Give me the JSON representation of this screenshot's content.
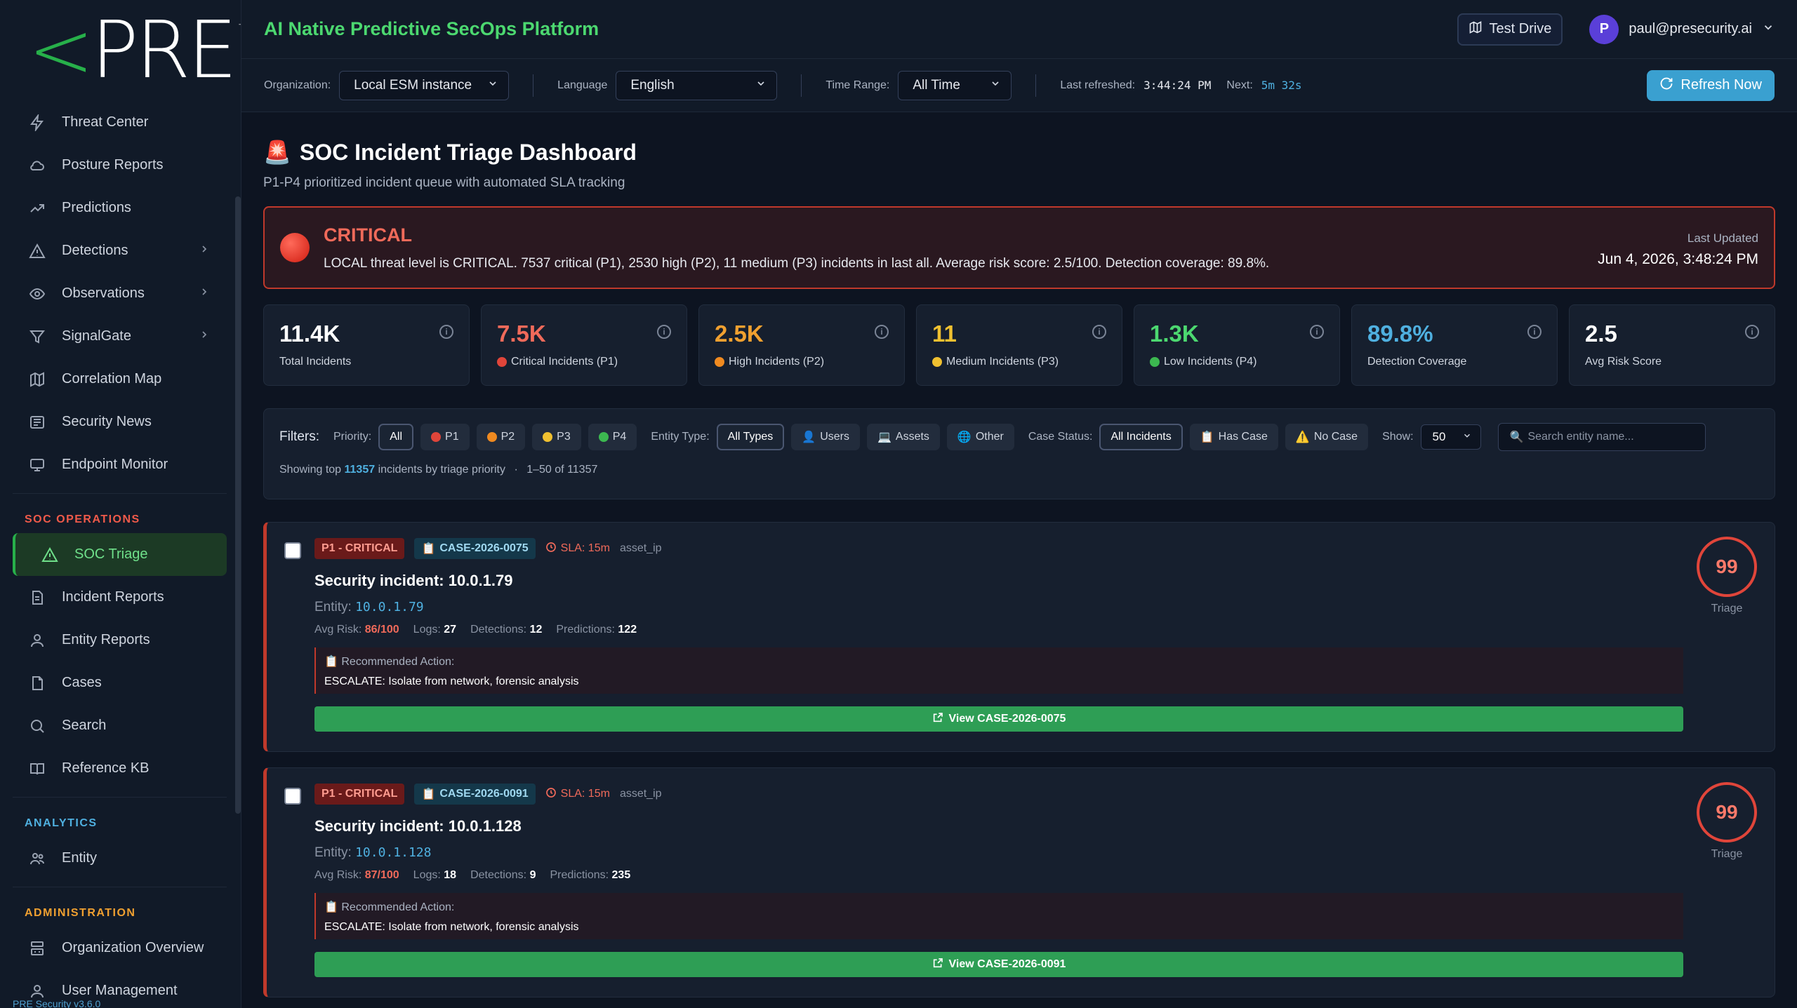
{
  "sidebar": {
    "logo": {
      "lt": "<",
      "text": "PRE",
      "tm": "TM"
    },
    "items_top": [
      {
        "label": "Threat Center",
        "icon": "bolt-icon"
      },
      {
        "label": "Posture Reports",
        "icon": "cloud-icon"
      },
      {
        "label": "Predictions",
        "icon": "trend-icon"
      },
      {
        "label": "Detections",
        "icon": "warning-icon",
        "chevron": true
      },
      {
        "label": "Observations",
        "icon": "eye-icon",
        "chevron": true
      },
      {
        "label": "SignalGate",
        "icon": "funnel-icon",
        "chevron": true
      },
      {
        "label": "Correlation Map",
        "icon": "map-icon"
      },
      {
        "label": "Security News",
        "icon": "news-icon"
      },
      {
        "label": "Endpoint Monitor",
        "icon": "monitor-icon"
      }
    ],
    "soc_heading": "SOC OPERATIONS",
    "soc_items": [
      {
        "label": "SOC Triage",
        "icon": "warning-icon",
        "active": true
      },
      {
        "label": "Incident Reports",
        "icon": "doc-icon"
      },
      {
        "label": "Entity Reports",
        "icon": "user-icon"
      },
      {
        "label": "Cases",
        "icon": "file-icon"
      },
      {
        "label": "Search",
        "icon": "search-icon"
      },
      {
        "label": "Reference KB",
        "icon": "book-icon"
      }
    ],
    "analytics_heading": "ANALYTICS",
    "analytics_items": [
      {
        "label": "Entity",
        "icon": "users-icon"
      }
    ],
    "admin_heading": "ADMINISTRATION",
    "admin_items": [
      {
        "label": "Organization Overview",
        "icon": "org-icon"
      },
      {
        "label": "User Management",
        "icon": "user-group-icon"
      }
    ],
    "version": "PRE Security v3.6.0"
  },
  "header": {
    "title": "AI Native Predictive SecOps Platform",
    "test_drive": "Test Drive",
    "user_initial": "P",
    "user_email": "paul@presecurity.ai"
  },
  "filterbar": {
    "org_label": "Organization:",
    "org_value": "Local ESM instance",
    "lang_label": "Language",
    "lang_value": "English",
    "time_label": "Time Range:",
    "time_value": "All Time",
    "last_refreshed_label": "Last refreshed:",
    "last_refreshed_value": "3:44:24 PM",
    "next_label": "Next:",
    "next_value": "5m 32s",
    "refresh_label": "Refresh Now"
  },
  "page": {
    "icon": "🚨",
    "title": "SOC Incident Triage Dashboard",
    "subtitle": "P1-P4 prioritized incident queue with automated SLA tracking"
  },
  "alert": {
    "level": "CRITICAL",
    "text": "LOCAL threat level is CRITICAL. 7537 critical (P1), 2530 high (P2), 11 medium (P3) incidents in last all. Average risk score: 2.5/100. Detection coverage: 89.8%.",
    "updated_label": "Last Updated",
    "updated_value": "Jun 4, 2026, 3:48:24 PM"
  },
  "stats": [
    {
      "value": "11.4K",
      "label": "Total Incidents",
      "color": "#ffffff",
      "dot": ""
    },
    {
      "value": "7.5K",
      "label": "Critical Incidents (P1)",
      "color": "#f06a5a",
      "dot": "#e0453a"
    },
    {
      "value": "2.5K",
      "label": "High Incidents (P2)",
      "color": "#f0a030",
      "dot": "#f08a20"
    },
    {
      "value": "11",
      "label": "Medium Incidents (P3)",
      "color": "#f0c030",
      "dot": "#f0c030"
    },
    {
      "value": "1.3K",
      "label": "Low Incidents (P4)",
      "color": "#4cd870",
      "dot": "#3cb850"
    },
    {
      "value": "89.8%",
      "label": "Detection Coverage",
      "color": "#4fb0e0",
      "dot": ""
    },
    {
      "value": "2.5",
      "label": "Avg Risk Score",
      "color": "#ffffff",
      "dot": ""
    }
  ],
  "filters": {
    "title": "Filters:",
    "priority_label": "Priority:",
    "priority_opts": [
      {
        "label": "All",
        "on": true,
        "dot": ""
      },
      {
        "label": "P1",
        "on": false,
        "dot": "#e0453a"
      },
      {
        "label": "P2",
        "on": false,
        "dot": "#f08a20"
      },
      {
        "label": "P3",
        "on": false,
        "dot": "#f0c030"
      },
      {
        "label": "P4",
        "on": false,
        "dot": "#3cb850"
      }
    ],
    "entity_label": "Entity Type:",
    "entity_opts": [
      {
        "label": "All Types",
        "on": true,
        "glyph": ""
      },
      {
        "label": "Users",
        "on": false,
        "glyph": "👤"
      },
      {
        "label": "Assets",
        "on": false,
        "glyph": "💻"
      },
      {
        "label": "Other",
        "on": false,
        "glyph": "🌐"
      }
    ],
    "case_label": "Case Status:",
    "case_opts": [
      {
        "label": "All Incidents",
        "on": true,
        "glyph": ""
      },
      {
        "label": "Has Case",
        "on": false,
        "glyph": "📋"
      },
      {
        "label": "No Case",
        "on": false,
        "glyph": "⚠️"
      }
    ],
    "show_label": "Show:",
    "show_value": "50",
    "search_placeholder": "Search entity name...",
    "showing_pre": "Showing top",
    "showing_count": "11357",
    "showing_post": "incidents by triage priority",
    "range": "1–50 of 11357"
  },
  "incidents": [
    {
      "priority": "P1 - CRITICAL",
      "case": "CASE-2026-0075",
      "sla": "SLA: 15m",
      "entity_type": "asset_ip",
      "title": "Security incident: 10.0.1.79",
      "entity_label": "Entity:",
      "entity": "10.0.1.79",
      "avg_risk": "86/100",
      "logs": "27",
      "detections": "12",
      "predictions": "122",
      "rec_label": "Recommended Action:",
      "rec_value": "ESCALATE: Isolate from network, forensic analysis",
      "view_label": "View CASE-2026-0075",
      "score": "99",
      "score_label": "Triage"
    },
    {
      "priority": "P1 - CRITICAL",
      "case": "CASE-2026-0091",
      "sla": "SLA: 15m",
      "entity_type": "asset_ip",
      "title": "Security incident: 10.0.1.128",
      "entity_label": "Entity:",
      "entity": "10.0.1.128",
      "avg_risk": "87/100",
      "logs": "18",
      "detections": "9",
      "predictions": "235",
      "rec_label": "Recommended Action:",
      "rec_value": "ESCALATE: Isolate from network, forensic analysis",
      "view_label": "View CASE-2026-0091",
      "score": "99",
      "score_label": "Triage"
    }
  ],
  "metric_labels": {
    "avg_risk": "Avg Risk:",
    "logs": "Logs:",
    "detections": "Detections:",
    "predictions": "Predictions:"
  }
}
